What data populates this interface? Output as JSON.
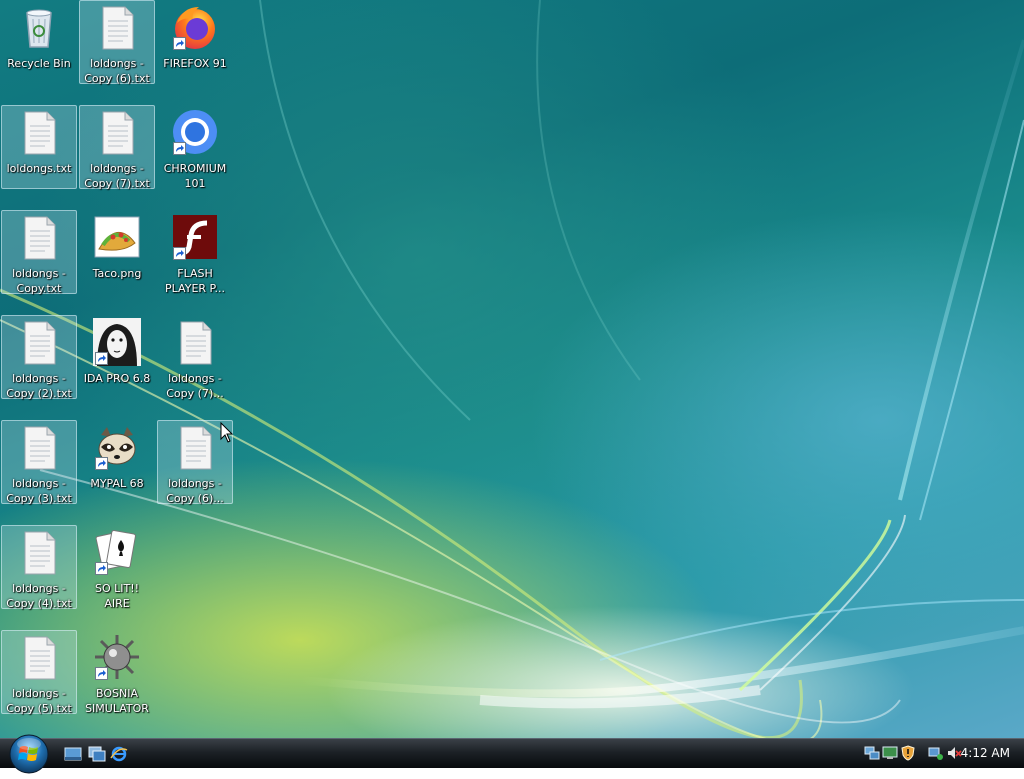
{
  "desktop": {
    "icons": [
      {
        "label": "Recycle Bin"
      },
      {
        "label": "loldongs - Copy (6).txt"
      },
      {
        "label": "FIREFOX 91"
      },
      {
        "label": "loldongs.txt"
      },
      {
        "label": "loldongs - Copy (7).txt"
      },
      {
        "label": "CHROMIUM 101"
      },
      {
        "label": "loldongs - Copy.txt"
      },
      {
        "label": "Taco.png"
      },
      {
        "label": "FLASH PLAYER P..."
      },
      {
        "label": "loldongs - Copy (2).txt"
      },
      {
        "label": "IDA PRO 6.8"
      },
      {
        "label": "loldongs - Copy (7)..."
      },
      {
        "label": "loldongs - Copy (3).txt"
      },
      {
        "label": "MYPAL 68"
      },
      {
        "label": "loldongs - Copy (6)..."
      },
      {
        "label": "loldongs - Copy (4).txt"
      },
      {
        "label": "SO LIT!! AIRE"
      },
      {
        "label": "loldongs - Copy (5).txt"
      },
      {
        "label": "BOSNIA SIMULATOR"
      }
    ]
  },
  "taskbar": {
    "clock": "4:12 AM",
    "quick_launch": [
      "show-desktop-icon",
      "switch-windows-icon",
      "internet-explorer-icon"
    ],
    "tray_icons": [
      "network-icon",
      "security-shield-icon",
      "volume-muted-icon"
    ]
  },
  "colors": {
    "selection": "#c8e6f0",
    "taskbar": "#1c2126",
    "label_text": "#ffffff"
  }
}
